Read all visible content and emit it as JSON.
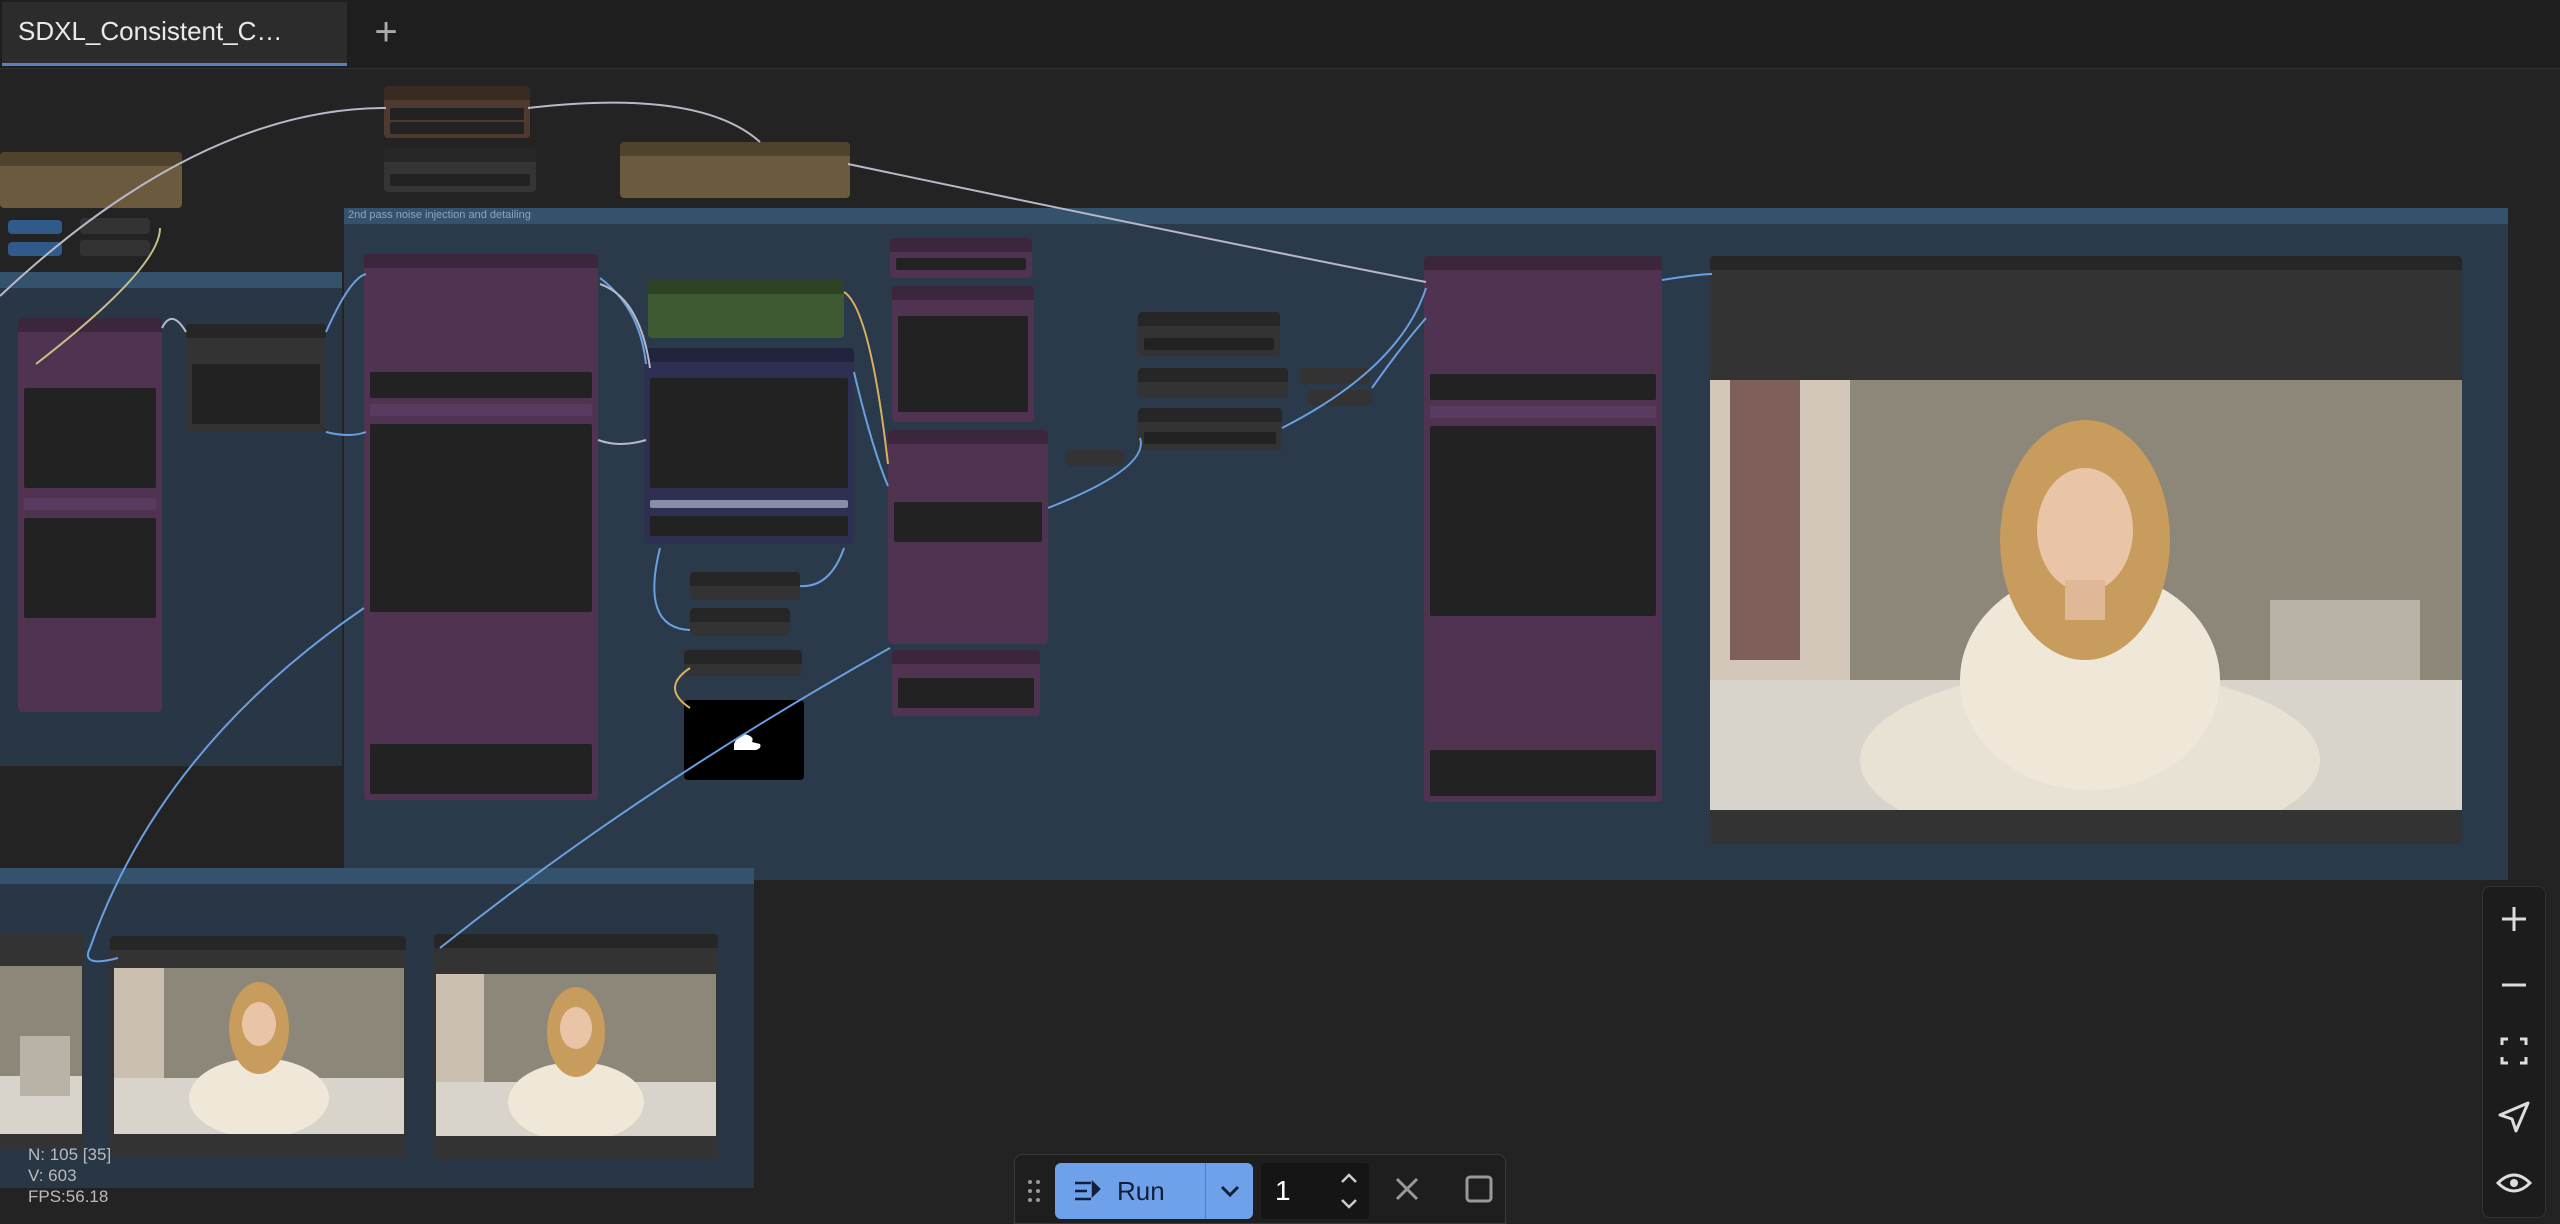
{
  "tabs": [
    {
      "label": "SDXL_Consistent_C…",
      "active": true
    }
  ],
  "new_tab_icon": "plus-icon",
  "groups": [
    {
      "label": "2nd pass noise injection and detailing"
    }
  ],
  "stats": {
    "n": "N: 105 [35]",
    "v": "V: 603",
    "fps": "FPS:56.18"
  },
  "run_toolbar": {
    "run_label": "Run",
    "queue_count": "1",
    "icons": [
      "drag-handle-icon",
      "run-queue-icon",
      "chevron-down-icon",
      "chevron-up-icon",
      "close-icon",
      "stop-square-icon"
    ]
  },
  "zoom_controls": {
    "icons": [
      "zoom-in-icon",
      "zoom-out-icon",
      "fit-view-icon",
      "navigate-icon",
      "visibility-icon"
    ]
  },
  "colors": {
    "accent": "#6ea1ea",
    "node_purple": "#4f3350",
    "group_blue": "#2c3d4e",
    "canvas": "#232323"
  }
}
